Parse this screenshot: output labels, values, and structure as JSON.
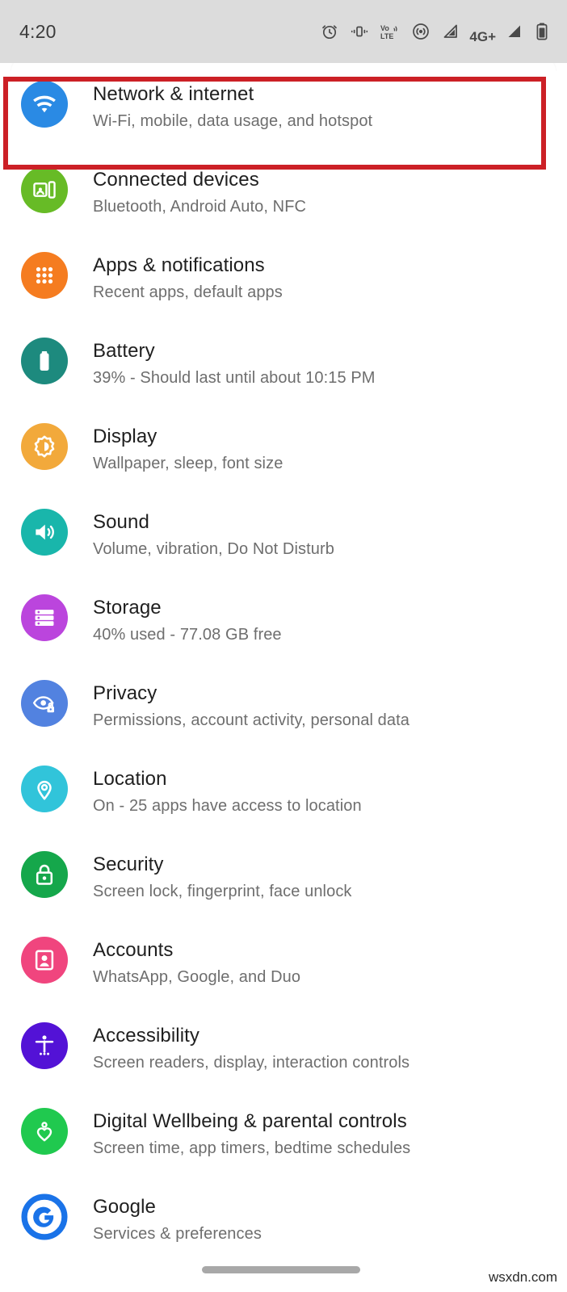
{
  "status_bar": {
    "time": "4:20",
    "network_label": "4G+",
    "icons": [
      "alarm-icon",
      "vibrate-icon",
      "volte-icon",
      "hotspot-icon",
      "signal-1-icon",
      "signal-2-icon",
      "battery-icon"
    ]
  },
  "highlight": {
    "color": "#cc2026",
    "target": "Network & internet"
  },
  "settings": {
    "items": [
      {
        "title": "Network & internet",
        "subtitle": "Wi-Fi, mobile, data usage, and hotspot",
        "icon": "wifi-icon",
        "color": "#2a8ae4"
      },
      {
        "title": "Connected devices",
        "subtitle": "Bluetooth, Android Auto, NFC",
        "icon": "devices-icon",
        "color": "#67bb26"
      },
      {
        "title": "Apps & notifications",
        "subtitle": "Recent apps, default apps",
        "icon": "apps-grid-icon",
        "color": "#f57c20"
      },
      {
        "title": "Battery",
        "subtitle": "39% - Should last until about 10:15 PM",
        "icon": "battery-icon",
        "color": "#1d8a7e"
      },
      {
        "title": "Display",
        "subtitle": "Wallpaper, sleep, font size",
        "icon": "brightness-icon",
        "color": "#f2a93b"
      },
      {
        "title": "Sound",
        "subtitle": "Volume, vibration, Do Not Disturb",
        "icon": "speaker-icon",
        "color": "#19b6ab"
      },
      {
        "title": "Storage",
        "subtitle": "40% used - 77.08 GB free",
        "icon": "storage-icon",
        "color": "#bb45dd"
      },
      {
        "title": "Privacy",
        "subtitle": "Permissions, account activity, personal data",
        "icon": "eye-lock-icon",
        "color": "#5282e0"
      },
      {
        "title": "Location",
        "subtitle": "On - 25 apps have access to location",
        "icon": "location-pin-icon",
        "color": "#31c4da"
      },
      {
        "title": "Security",
        "subtitle": "Screen lock, fingerprint, face unlock",
        "icon": "lock-icon",
        "color": "#15a74b"
      },
      {
        "title": "Accounts",
        "subtitle": "WhatsApp, Google, and Duo",
        "icon": "account-badge-icon",
        "color": "#f0457e"
      },
      {
        "title": "Accessibility",
        "subtitle": "Screen readers, display, interaction controls",
        "icon": "accessibility-icon",
        "color": "#5312d6"
      },
      {
        "title": "Digital Wellbeing & parental controls",
        "subtitle": "Screen time, app timers, bedtime schedules",
        "icon": "wellbeing-heart-icon",
        "color": "#20c94f"
      },
      {
        "title": "Google",
        "subtitle": "Services & preferences",
        "icon": "google-g-icon",
        "color": "#1a73e8"
      }
    ]
  },
  "watermark": "wsxdn.com"
}
